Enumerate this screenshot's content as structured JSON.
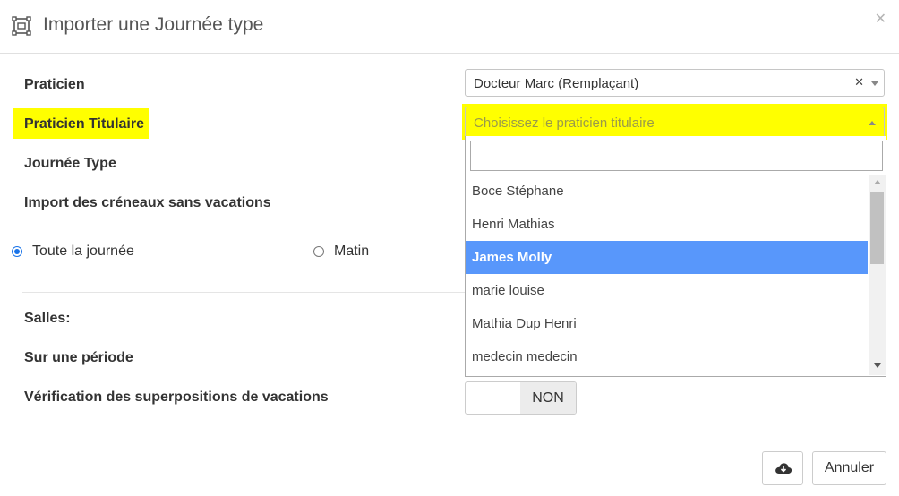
{
  "modal": {
    "title": "Importer une Journée type"
  },
  "form": {
    "praticien_label": "Praticien",
    "praticien_value": "Docteur Marc (Remplaçant)",
    "titulaire_label": "Praticien Titulaire",
    "titulaire_placeholder": "Choisissez le praticien titulaire",
    "journee_label": "Journée Type",
    "import_label": "Import des créneaux sans vacations",
    "radio_all": "Toute la journée",
    "radio_matin": "Matin",
    "salles_label": "Salles:",
    "periode_label": "Sur une période",
    "verif_label": "Vérification des superpositions de vacations",
    "verif_value": "NON"
  },
  "dropdown": {
    "options": [
      "Boce Stéphane",
      "Henri Mathias",
      "James Molly",
      "marie louise",
      "Mathia Dup Henri",
      "medecin medecin"
    ],
    "highlighted": "James Molly"
  },
  "footer": {
    "cancel_label": "Annuler",
    "import_icon": "cloud-download-icon"
  },
  "colors": {
    "highlight": "#ffff00",
    "option_active": "#5897fb",
    "radio_checked": "#1a73e8"
  }
}
